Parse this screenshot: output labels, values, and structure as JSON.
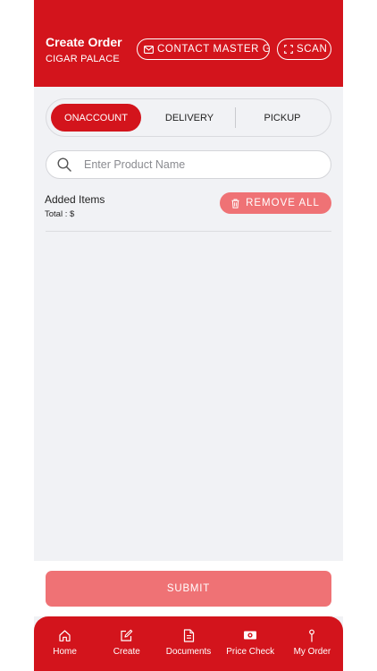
{
  "header": {
    "title": "Create Order",
    "subtitle": "CIGAR PALACE",
    "contact_label": "CONTACT MASTER G",
    "scan_label": "SCAN"
  },
  "order_type": {
    "options": [
      "ONACCOUNT",
      "DELIVERY",
      "PICKUP"
    ],
    "selected": "ONACCOUNT"
  },
  "search": {
    "placeholder": "Enter Product Name",
    "value": ""
  },
  "items": {
    "title": "Added Items",
    "total": "Total : $",
    "remove_all_label": "REMOVE ALL"
  },
  "submit_label": "SUBMIT",
  "bottom_nav": [
    {
      "label": "Home",
      "icon": "home-icon"
    },
    {
      "label": "Create",
      "icon": "edit-icon"
    },
    {
      "label": "Documents",
      "icon": "document-icon"
    },
    {
      "label": "Price Check",
      "icon": "money-icon"
    },
    {
      "label": "My Order",
      "icon": "pin-icon"
    }
  ],
  "colors": {
    "brand_red": "#d3141c",
    "disabled_red": "#ef7275",
    "background": "#f1f2f5"
  }
}
